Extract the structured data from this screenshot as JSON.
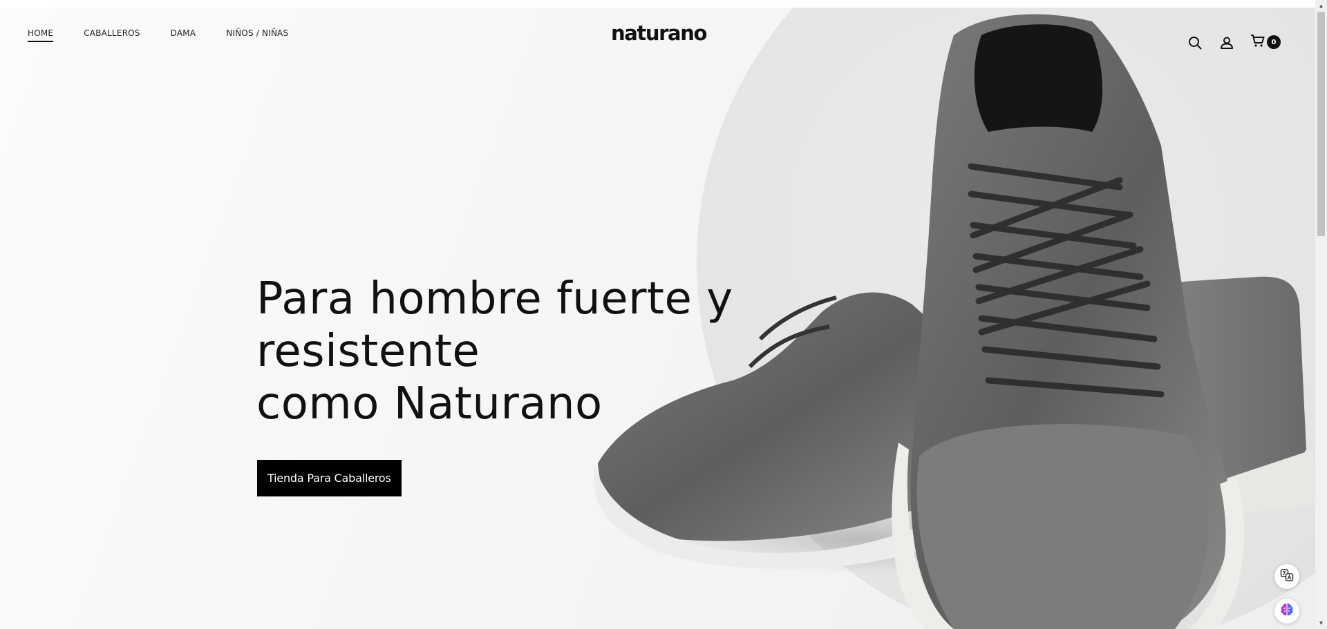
{
  "header": {
    "nav": [
      {
        "label": "HOME",
        "active": true
      },
      {
        "label": "CABALLEROS",
        "active": false
      },
      {
        "label": "DAMA",
        "active": false
      },
      {
        "label": "NIÑOS / NIÑAS",
        "active": false
      }
    ],
    "logo": "naturano",
    "icons": [
      "search-icon",
      "user-icon",
      "cart-icon"
    ],
    "cart_count": "0"
  },
  "hero": {
    "title_lines": [
      "Para hombre fuerte y",
      "resistente",
      "como Naturano"
    ],
    "cta_label": "Tienda Para Caballeros",
    "image": "gray-leather-sneakers"
  },
  "widgets": [
    "translate-icon",
    "brain-icon"
  ],
  "colors": {
    "text": "#111111",
    "cta_bg": "#000000",
    "cta_text": "#ffffff",
    "background": "#f6f6f6"
  }
}
